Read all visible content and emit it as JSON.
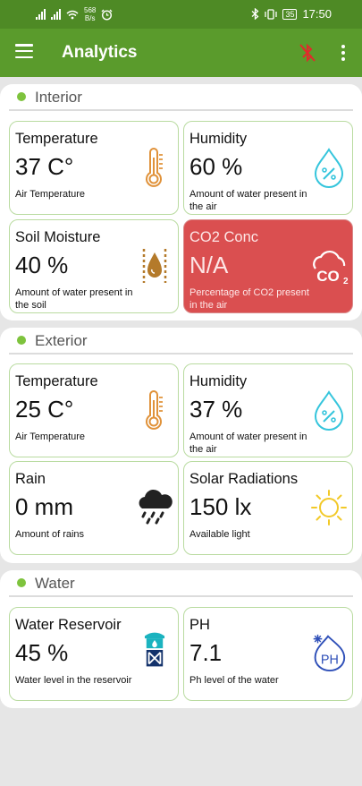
{
  "status_bar": {
    "net_speed_value": "568",
    "net_speed_unit": "B/s",
    "battery": "35",
    "time": "17:50"
  },
  "app_bar": {
    "title": "Analytics",
    "icons": [
      "menu-icon",
      "bluetooth-disabled-icon",
      "more-vert-icon"
    ]
  },
  "sections": [
    {
      "title": "Interior",
      "cards": [
        {
          "title": "Temperature",
          "value": "37 C°",
          "desc": "Air Temperature",
          "icon": "thermometer-icon"
        },
        {
          "title": "Humidity",
          "value": "60 %",
          "desc": "Amount of water present in the air",
          "icon": "water-drop-percent-icon"
        },
        {
          "title": "Soil Moisture",
          "value": "40 %",
          "desc": "Amount of water present in the soil",
          "icon": "soil-moisture-icon"
        },
        {
          "title": "CO2 Conc",
          "value": "N/A",
          "desc": "Percentage of CO2 present in the air",
          "icon": "co2-cloud-icon"
        }
      ]
    },
    {
      "title": "Exterior",
      "cards": [
        {
          "title": "Temperature",
          "value": "25 C°",
          "desc": "Air Temperature",
          "icon": "thermometer-icon"
        },
        {
          "title": "Humidity",
          "value": "37 %",
          "desc": "Amount of water present in the air",
          "icon": "water-drop-percent-icon"
        },
        {
          "title": "Rain",
          "value": "0 mm",
          "desc": "Amount of rains",
          "icon": "rain-cloud-icon"
        },
        {
          "title": "Solar Radiations",
          "value": "150 lx",
          "desc": "Available light",
          "icon": "sun-icon"
        }
      ]
    },
    {
      "title": "Water",
      "cards": [
        {
          "title": "Water Reservoir",
          "value": "45 %",
          "desc": "Water level in the reservoir",
          "icon": "water-tower-icon"
        },
        {
          "title": "PH",
          "value": "7.1",
          "desc": "Ph level of the water",
          "icon": "ph-drop-icon"
        }
      ]
    }
  ],
  "colors": {
    "status_bar": "#4e8a25",
    "app_bar": "#5a9b2c",
    "accent_dot": "#7ec33d",
    "card_border": "#b9dba0",
    "alert_card": "#da4f50",
    "thermometer": "#e0923a",
    "humidity": "#35c5dc",
    "soil": "#b47a2a",
    "sun": "#f2c928",
    "ph": "#2e4fb8",
    "bluetooth_off": "#e02b2b"
  }
}
